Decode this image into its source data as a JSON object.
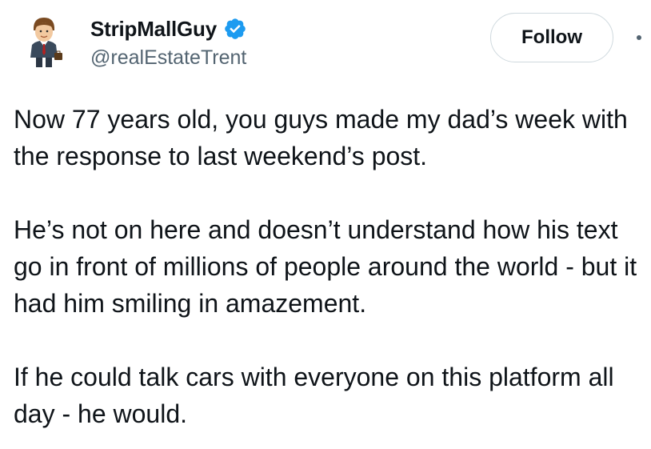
{
  "author": {
    "display_name": "StripMallGuy",
    "handle": "@realEstateTrent",
    "avatar_icon": "businessman-avatar-icon",
    "verified_icon": "verified-badge-icon"
  },
  "actions": {
    "follow_label": "Follow",
    "more_icon": "more-options-icon"
  },
  "tweet": {
    "paragraphs": [
      "Now 77 years old, you guys made my dad’s week with the response to last weekend’s post.",
      "He’s not on here and doesn’t understand how his text go in front of millions of people around the world - but it had him smiling in amazement.",
      "If he could talk cars with everyone on this platform all day - he would."
    ]
  },
  "colors": {
    "verified_blue": "#1d9bf0",
    "text_primary": "#0f1419",
    "text_secondary": "#536471",
    "button_border": "#cfd9de"
  }
}
